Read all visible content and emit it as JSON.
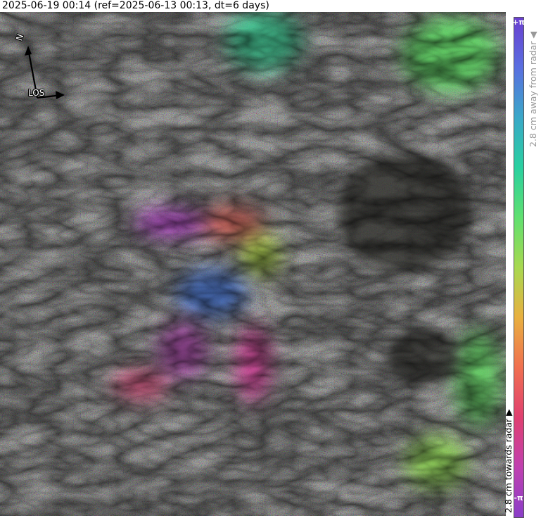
{
  "title": "2025-06-19 00:14 (ref=2025-06-13 00:13, dt=6 days)",
  "map": {
    "north_label": "N",
    "los_label": "LOS",
    "north_icon": "north-arrow-icon",
    "los_icon": "los-arrow-icon"
  },
  "colorbar": {
    "top_label": "+π",
    "bottom_label": "-π",
    "away_text": "2.8 cm away from radar",
    "towards_text": "2.8 cm towards radar",
    "colors": [
      "#6a3fd0",
      "#5a6fe0",
      "#3aa8c8",
      "#2ad0a0",
      "#60e070",
      "#a8d850",
      "#e8b040",
      "#f07050",
      "#e04070",
      "#c040b0",
      "#8a3ec8"
    ]
  }
}
